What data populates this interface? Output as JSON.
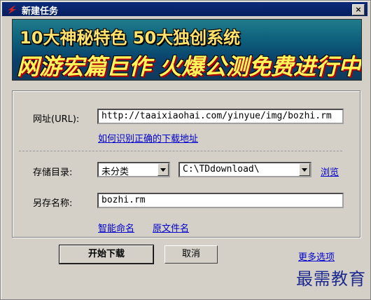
{
  "window": {
    "title": "新建任务",
    "close_label": "×"
  },
  "banner": {
    "line1": "10大神秘特色 50大独创系统",
    "line2": "网游宏篇巨作 火爆公测免费进行中"
  },
  "form": {
    "url_label": "网址(URL):",
    "url_value": "http://taaixiaohai.com/yinyue/img/bozhi.rm",
    "help_link": "如何识别正确的下载地址",
    "dir_label": "存储目录:",
    "category_value": "未分类",
    "path_value": "C:\\TDdownload\\",
    "browse_link": "浏览",
    "saveas_label": "另存名称:",
    "saveas_value": "bozhi.rm",
    "smart_name_link": "智能命名",
    "orig_name_link": "原文件名"
  },
  "buttons": {
    "start": "开始下载",
    "cancel": "取消",
    "more": "更多选项"
  },
  "watermark": "最需教育",
  "colors": {
    "titlebar": "#0b2a7a",
    "link": "#0000cc"
  },
  "icons": {
    "app": "thunder-icon",
    "dropdown": "triangle-down-icon"
  }
}
